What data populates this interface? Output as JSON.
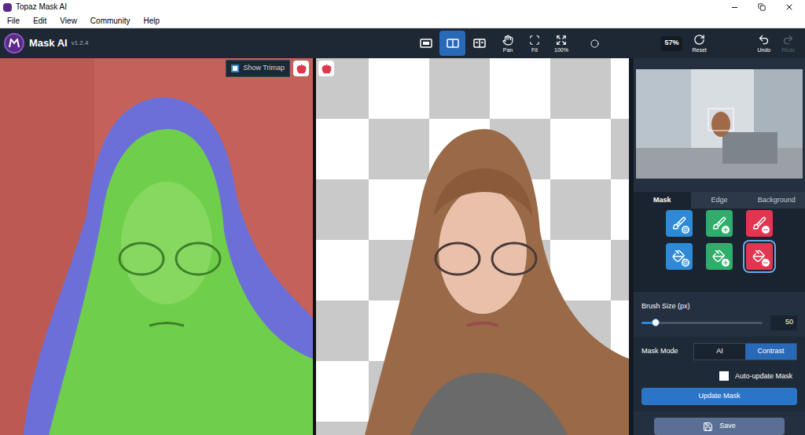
{
  "window": {
    "title": "Topaz Mask AI"
  },
  "menu": [
    "File",
    "Edit",
    "View",
    "Community",
    "Help"
  ],
  "app": {
    "name": "Mask AI",
    "version": "v1.2.4"
  },
  "view_modes": [
    {
      "kind": "single",
      "selected": false
    },
    {
      "kind": "split",
      "selected": true
    },
    {
      "kind": "side",
      "selected": false
    }
  ],
  "tools": [
    {
      "label": "Pan",
      "kind": "pan"
    },
    {
      "label": "Fit",
      "kind": "fit"
    },
    {
      "label": "100%",
      "kind": "actual"
    }
  ],
  "zoom": "57%",
  "reset": "Reset",
  "history": [
    {
      "label": "Undo",
      "kind": "undo",
      "disabled": false
    },
    {
      "label": "Redo",
      "kind": "redo",
      "disabled": true
    }
  ],
  "show_trimap": {
    "label": "Show Trimap",
    "checked": true
  },
  "sidebar": {
    "tabs": [
      {
        "label": "Mask",
        "selected": true
      },
      {
        "label": "Edge",
        "selected": false
      },
      {
        "label": "Background",
        "selected": false
      }
    ],
    "brushes": [
      {
        "kind": "brush-compute",
        "color": "#2d8ad6",
        "selected": false
      },
      {
        "kind": "brush-keep",
        "color": "#2fae6b",
        "selected": false
      },
      {
        "kind": "brush-cut",
        "color": "#e0364f",
        "selected": false
      },
      {
        "kind": "fill-compute",
        "color": "#2d8ad6",
        "selected": false
      },
      {
        "kind": "fill-keep",
        "color": "#2fae6b",
        "selected": false
      },
      {
        "kind": "fill-cut",
        "color": "#e0364f",
        "selected": true
      }
    ],
    "brush_size": {
      "label": "Brush Size (px)",
      "value": "50",
      "level": 0.12
    },
    "mask_mode": {
      "label": "Mask Mode",
      "options": [
        {
          "label": "AI",
          "selected": false
        },
        {
          "label": "Contrast",
          "selected": true
        }
      ]
    },
    "auto_update": {
      "label": "Auto-update Mask",
      "checked": false
    },
    "update_button": "Update Mask",
    "save_button": "Save"
  }
}
